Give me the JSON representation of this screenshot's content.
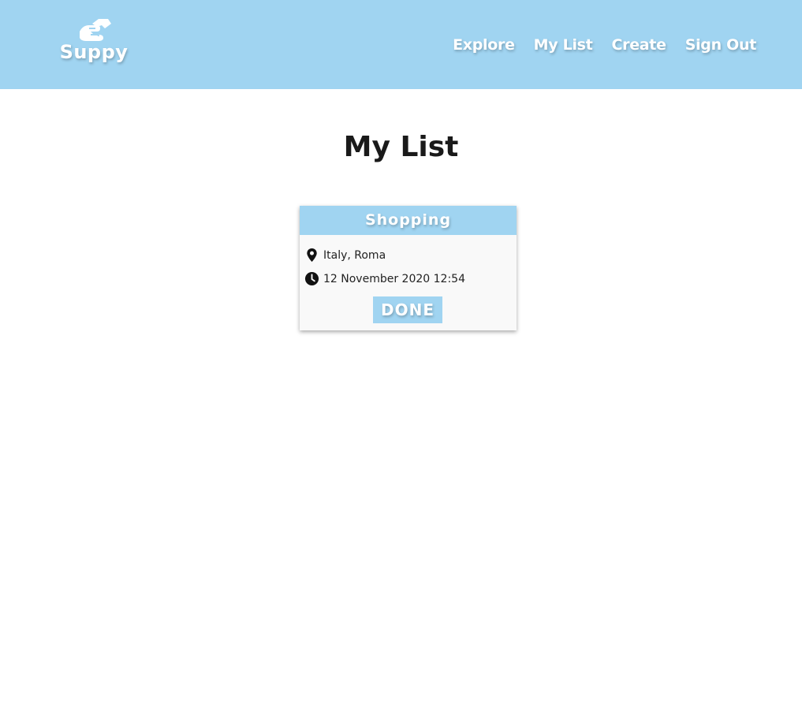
{
  "header": {
    "brand_name": "Suppy",
    "brand_icon": "handshake-icon",
    "nav": [
      {
        "label": "Explore"
      },
      {
        "label": "My List"
      },
      {
        "label": "Create"
      },
      {
        "label": "Sign Out"
      }
    ],
    "color": "#a0d4f1"
  },
  "main": {
    "title": "My List",
    "cards": [
      {
        "title": "Shopping",
        "location": "Italy, Roma",
        "location_icon": "map-pin-icon",
        "datetime": "12 November 2020 12:54",
        "datetime_icon": "clock-icon",
        "action_label": "DONE"
      }
    ]
  }
}
